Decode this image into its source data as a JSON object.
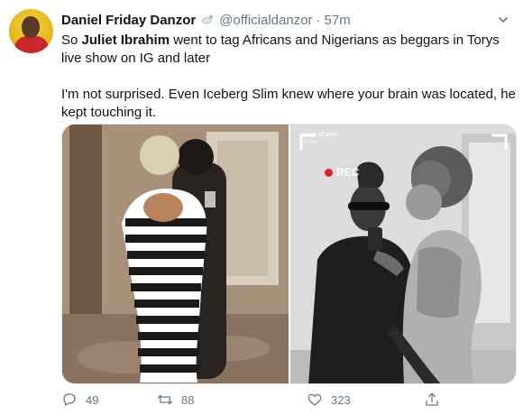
{
  "tweet": {
    "author_name": "Daniel Friday Danzor",
    "handle": "@officialdanzor",
    "separator": "·",
    "time": "57m",
    "text": {
      "p1_before": "So ",
      "p1_bold": "Juliet Ibrahim",
      "p1_after": " went to tag Africans and Nigerians as beggars in Torys live show on IG and later",
      "p2": "I'm not surprised. Even Iceberg Slim knew where your brain was located, he kept touching it."
    },
    "media": {
      "right_overlay": {
        "name": "Juliet Ibrahim",
        "time": "1h ago",
        "rec": "REC"
      }
    },
    "counts": {
      "replies": "49",
      "retweets": "88",
      "likes": "323"
    }
  },
  "icons": {
    "name_emoji": "dove-icon",
    "menu": "chevron-down-icon",
    "reply": "reply-icon",
    "retweet": "retweet-icon",
    "like": "heart-icon",
    "share": "share-icon"
  },
  "colors": {
    "text": "#0f1419",
    "secondary": "#657786",
    "rec_red": "#e0202a"
  }
}
